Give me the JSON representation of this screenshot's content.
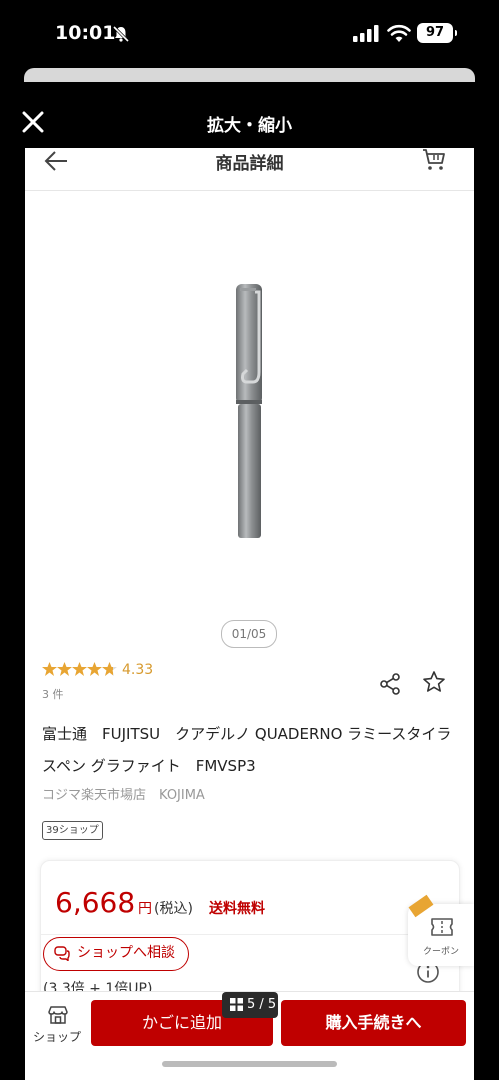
{
  "status_bar": {
    "time": "10:01",
    "battery": "97"
  },
  "modal": {
    "title": "拡大・縮小"
  },
  "nav": {
    "title": "商品詳細"
  },
  "gallery": {
    "counter": "01/05"
  },
  "review": {
    "rating": 4.33,
    "rating_text": "4.33",
    "count": "3 件"
  },
  "product": {
    "title": "富士通　FUJITSU　クアデルノ QUADERNO ラミースタイラスペン グラファイト　FMVSP3",
    "shop": "コジマ楽天市場店　KOJIMA",
    "badge": "39ショップ"
  },
  "price": {
    "amount": "6,668",
    "unit": "円",
    "tax": "(税込)",
    "shipping": "送料無料",
    "consult_label": "ショップへ相談",
    "points": "(3.3倍 + 1倍UP)"
  },
  "coupon": {
    "label": "クーポン"
  },
  "bottom_bar": {
    "shop_label": "ショップ",
    "cart_label": "かごに追加",
    "buy_label": "購入手続きへ",
    "page_indicator": "5 / 5"
  },
  "colors": {
    "accent": "#bf0000",
    "star": "#e8a533",
    "rating_text": "#d79a2e"
  },
  "icons": [
    "mute-bell-icon",
    "signal-icon",
    "wifi-icon",
    "close-icon",
    "back-arrow-icon",
    "cart-icon",
    "star-icon",
    "share-icon",
    "favorite-star-icon",
    "chat-icon",
    "info-icon",
    "coupon-ticket-icon",
    "shop-icon",
    "grid-icon"
  ]
}
